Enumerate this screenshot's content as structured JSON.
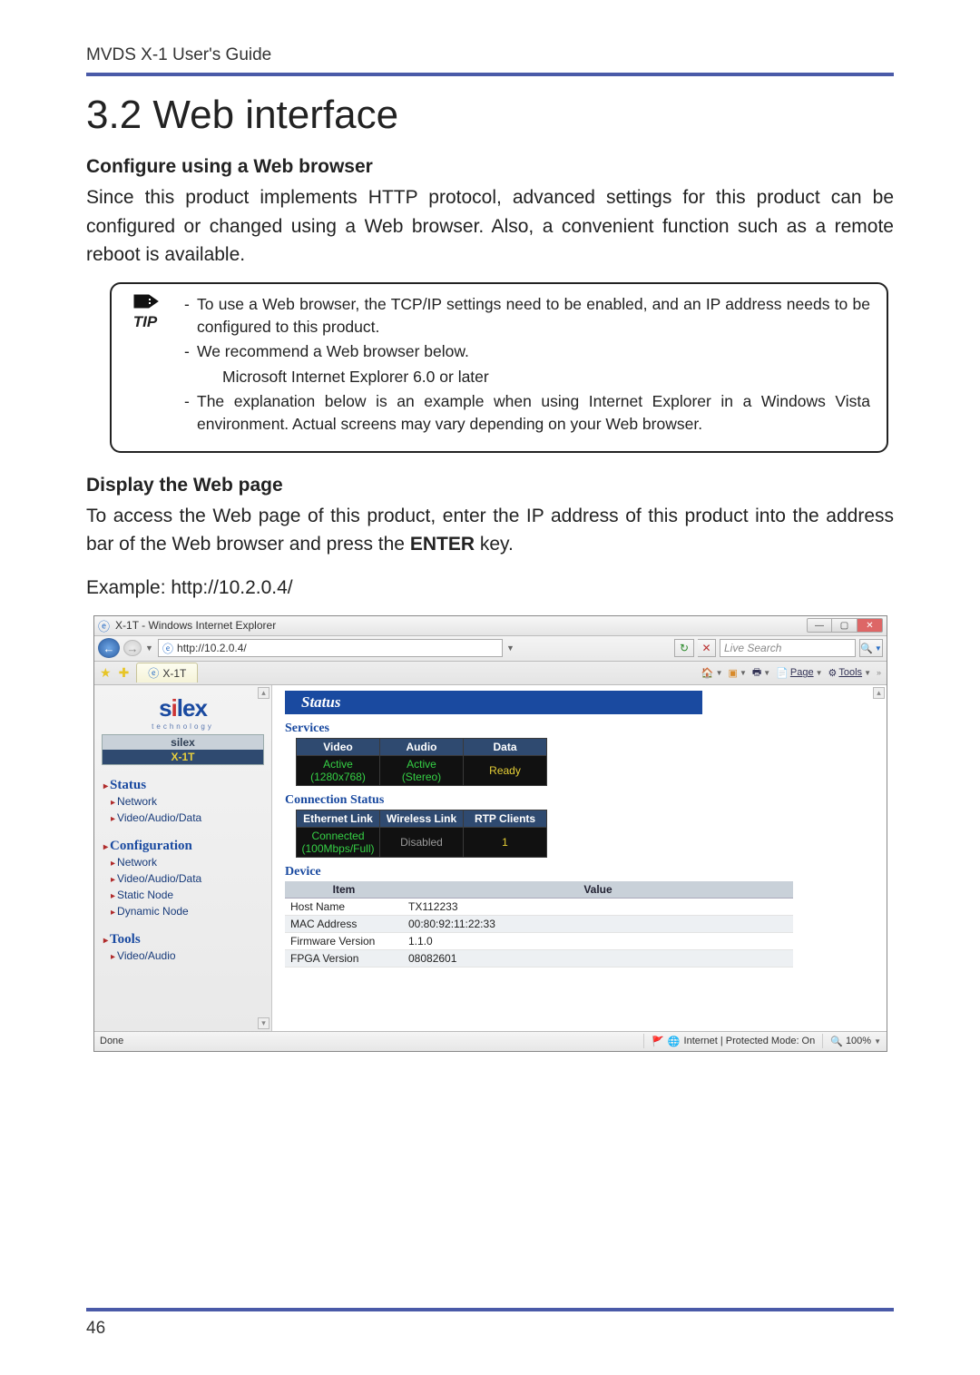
{
  "doc": {
    "running_head": "MVDS X-1 User's Guide",
    "section_title": "3.2 Web interface",
    "sub1": "Configure using a Web browser",
    "para1": "Since this product implements HTTP protocol, advanced settings for this product can be configured or changed using a Web browser. Also, a convenient function such as a remote reboot is available.",
    "tip_label": "TIP",
    "tip_items": {
      "a": "To use a Web browser, the TCP/IP settings need to be enabled, and an IP address needs to be configured to this product.",
      "b": "We recommend a Web browser below.",
      "b_sub": "Microsoft Internet Explorer 6.0 or later",
      "c": "The explanation below is an example when using Internet Explorer in a Windows Vista environment. Actual screens may vary depending on your Web browser."
    },
    "sub2": "Display the Web page",
    "para2_a": "To access the Web page of this product, enter the IP address of this product into the address bar of the Web browser and press the ",
    "para2_key": "ENTER",
    "para2_b": " key.",
    "example": "Example: http://10.2.0.4/",
    "page_number": "46"
  },
  "ie": {
    "window_title": "X-1T - Windows Internet Explorer",
    "url": "http://10.2.0.4/",
    "search_placeholder": "Live Search",
    "tab_label": "X-1T",
    "toolbar": {
      "page": "Page",
      "tools": "Tools"
    },
    "brand": {
      "name_pre": "s",
      "name_post": "lex",
      "sub": "technology",
      "row1": "silex",
      "row2": "X-1T"
    },
    "nav": {
      "status": "Status",
      "status_items": {
        "network": "Network",
        "vad": "Video/Audio/Data"
      },
      "config": "Configuration",
      "config_items": {
        "network": "Network",
        "vad": "Video/Audio/Data",
        "static": "Static Node",
        "dynamic": "Dynamic Node"
      },
      "tools": "Tools",
      "tools_items": {
        "va": "Video/Audio"
      }
    },
    "status_banner": "Status",
    "services": {
      "title": "Services",
      "cols": {
        "video": "Video",
        "audio": "Audio",
        "data": "Data"
      },
      "vals": {
        "video_l1": "Active",
        "video_l2": "(1280x768)",
        "audio_l1": "Active",
        "audio_l2": "(Stereo)",
        "data": "Ready"
      }
    },
    "conn": {
      "title": "Connection Status",
      "cols": {
        "eth": "Ethernet Link",
        "wl": "Wireless Link",
        "rtp": "RTP Clients"
      },
      "vals": {
        "eth_l1": "Connected",
        "eth_l2": "(100Mbps/Full)",
        "wl": "Disabled",
        "rtp": "1"
      }
    },
    "device": {
      "title": "Device",
      "head_item": "Item",
      "head_value": "Value",
      "rows": {
        "hostname_k": "Host Name",
        "hostname_v": "TX112233",
        "mac_k": "MAC Address",
        "mac_v": "00:80:92:11:22:33",
        "fw_k": "Firmware Version",
        "fw_v": "1.1.0",
        "fpga_k": "FPGA Version",
        "fpga_v": "08082601"
      }
    },
    "status_done": "Done",
    "status_zone": "Internet | Protected Mode: On",
    "zoom": "100%"
  }
}
